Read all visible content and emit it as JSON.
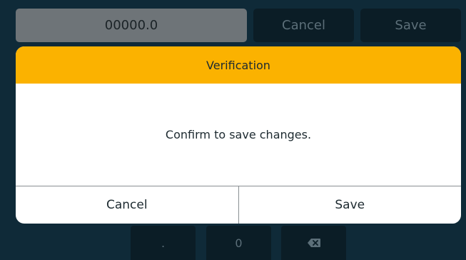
{
  "background": {
    "value_display": "00000.0",
    "cancel_label": "Cancel",
    "save_label": "Save",
    "keypad": {
      "dot_label": ".",
      "zero_label": "0",
      "backspace_icon": "backspace-icon"
    }
  },
  "dialog": {
    "title": "Verification",
    "message": "Confirm to save changes.",
    "cancel_label": "Cancel",
    "save_label": "Save"
  },
  "colors": {
    "header": "#fbb200",
    "background": "#0f2a38",
    "dialog": "#ffffff"
  }
}
